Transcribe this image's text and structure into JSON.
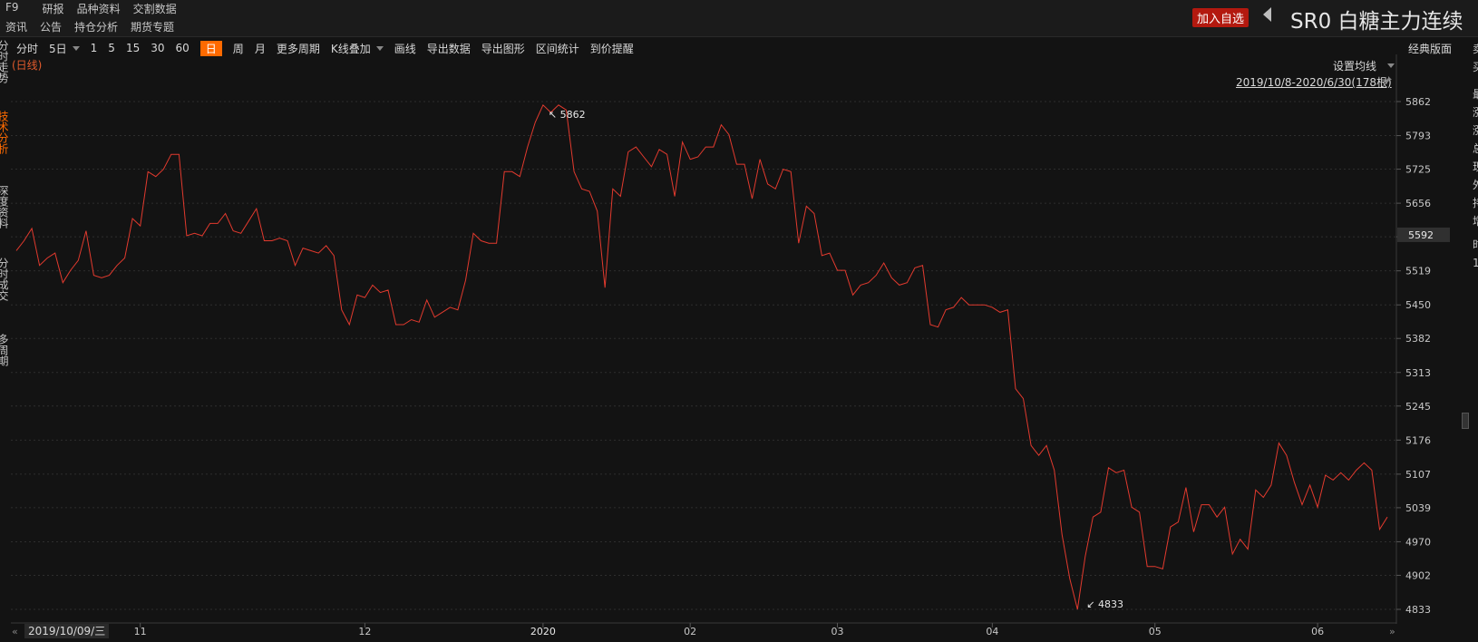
{
  "header": {
    "nav_row_1": [
      "F9",
      "研报",
      "品种资料",
      "交割数据"
    ],
    "nav_row_2": [
      "资讯",
      "公告",
      "持仓分析",
      "期货专题"
    ],
    "add_watch_label": "加入自选",
    "instrument_title": "SR0 白糖主力连续"
  },
  "toolbar": {
    "items": [
      "分时",
      "5日",
      "1",
      "5",
      "15",
      "30",
      "60",
      "日",
      "周",
      "月",
      "更多周期",
      "K线叠加",
      "画线",
      "导出数据",
      "导出图形",
      "区间统计",
      "到价提醒"
    ],
    "active": "日",
    "classic_layout_label": "经典版面"
  },
  "left_tabs": [
    "分时走势",
    "技术分析",
    "深度资料",
    "分时成交",
    "多周期"
  ],
  "left_tabs_active": "技术分析",
  "right_panel": [
    "卖",
    "买",
    "最",
    "涨",
    "涨",
    "总",
    "现",
    "外",
    "持",
    "增",
    "时",
    "1"
  ],
  "chart": {
    "period_label": "(日线)",
    "ma_setting_label": "设置均线",
    "date_range": "2019/10/8-2020/6/30(178根)",
    "start_date_label": "2019/10/09/三",
    "current_price_label": "5592",
    "max_label": "5862",
    "min_label": "4833",
    "line_color": "#e23a2e",
    "accent_color": "#ff6a00"
  },
  "chart_data": {
    "type": "line",
    "ylim": [
      4833,
      5862
    ],
    "y_ticks": [
      5862,
      5793,
      5725,
      5656,
      5588,
      5519,
      5450,
      5382,
      5313,
      5245,
      5176,
      5107,
      5039,
      4970,
      4902,
      4833
    ],
    "x_ticks": [
      "11",
      "12",
      "2020",
      "02",
      "03",
      "04",
      "05",
      "06"
    ],
    "values": [
      5560,
      5580,
      5605,
      5530,
      5545,
      5555,
      5495,
      5520,
      5540,
      5600,
      5510,
      5505,
      5510,
      5530,
      5545,
      5625,
      5610,
      5720,
      5710,
      5725,
      5755,
      5755,
      5590,
      5595,
      5590,
      5615,
      5615,
      5635,
      5600,
      5595,
      5620,
      5645,
      5580,
      5580,
      5585,
      5580,
      5530,
      5565,
      5560,
      5555,
      5570,
      5550,
      5440,
      5410,
      5470,
      5465,
      5490,
      5475,
      5480,
      5410,
      5410,
      5420,
      5415,
      5460,
      5425,
      5435,
      5445,
      5440,
      5500,
      5595,
      5580,
      5575,
      5575,
      5720,
      5720,
      5710,
      5770,
      5820,
      5855,
      5840,
      5855,
      5845,
      5720,
      5685,
      5680,
      5640,
      5485,
      5685,
      5670,
      5760,
      5770,
      5750,
      5730,
      5765,
      5755,
      5670,
      5780,
      5745,
      5750,
      5770,
      5770,
      5815,
      5795,
      5735,
      5735,
      5665,
      5745,
      5695,
      5685,
      5725,
      5720,
      5575,
      5650,
      5635,
      5550,
      5555,
      5520,
      5520,
      5470,
      5490,
      5495,
      5510,
      5535,
      5505,
      5490,
      5495,
      5525,
      5530,
      5410,
      5405,
      5440,
      5445,
      5465,
      5450,
      5450,
      5450,
      5445,
      5435,
      5440,
      5280,
      5260,
      5165,
      5145,
      5165,
      5115,
      4985,
      4895,
      4833,
      4940,
      5020,
      5030,
      5120,
      5110,
      5115,
      5040,
      5030,
      4920,
      4920,
      4915,
      5000,
      5010,
      5080,
      4990,
      5045,
      5045,
      5020,
      5040,
      4945,
      4975,
      4955,
      5075,
      5060,
      5085,
      5170,
      5145,
      5090,
      5045,
      5085,
      5040,
      5105,
      5095,
      5110,
      5095,
      5115,
      5130,
      5115,
      4995,
      5020
    ]
  }
}
